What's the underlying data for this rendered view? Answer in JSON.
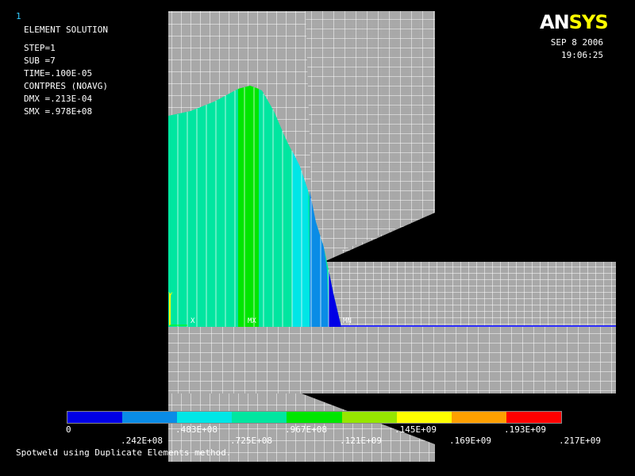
{
  "window_number": "1",
  "info_lines": [
    "ELEMENT SOLUTION",
    "STEP=1",
    "SUB =7",
    "TIME=.100E-05",
    "CONTPRES (NOAVG)",
    "DMX =.213E-04",
    "SMX =.978E+08"
  ],
  "logo": {
    "part1": "AN",
    "part2": "SYS"
  },
  "date": "SEP  8 2006",
  "time": "19:06:25",
  "legend": {
    "colors": [
      "#0000e6",
      "#0a8ce6",
      "#00e6e6",
      "#00e6a0",
      "#00e600",
      "#96e600",
      "#ffff00",
      "#ffa000",
      "#ff0000"
    ],
    "ticks_top": [
      "0",
      ".483E+08",
      ".967E+08",
      ".145E+09",
      ".193E+09"
    ],
    "ticks_bottom": [
      ".242E+08",
      ".725E+08",
      ".121E+09",
      ".169E+09",
      ".217E+09"
    ]
  },
  "markers": {
    "y": "Y",
    "x": "X",
    "mx": "MX",
    "mn": "MN"
  },
  "caption": "Spotweld using Duplicate Elements method."
}
